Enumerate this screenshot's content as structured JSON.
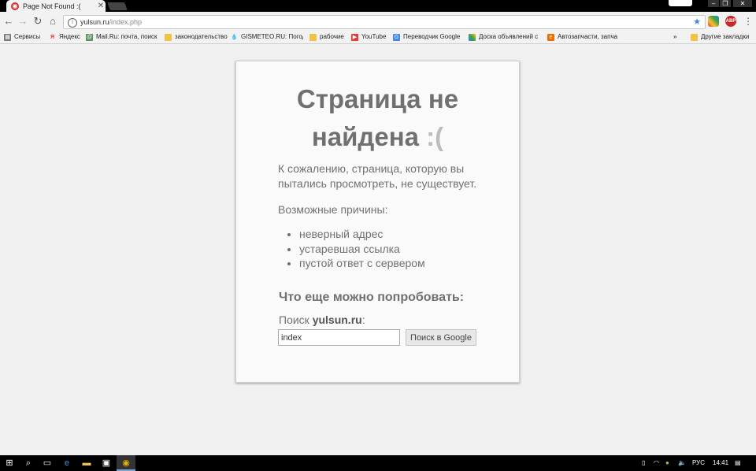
{
  "browser": {
    "tab_title": "Page Not Found :(",
    "address_host": "yulsun.ru",
    "address_path": "/index.php",
    "abp_label": "ABP",
    "bookmarks": [
      "Сервисы",
      "Яндекс",
      "Mail.Ru: почта, поиск",
      "законодательство",
      "GISMETEO.RU: Погод",
      "рабочие",
      "YouTube",
      "Переводчик Google",
      "Доска объявлений с",
      "Автозапчасти, запча"
    ],
    "overflow": "»",
    "other_bookmarks": "Другие закладки"
  },
  "page": {
    "title_line1": "Страница не",
    "title_line2": "найдена",
    "title_smile": ":(",
    "intro": "К сожалению, страница, которую вы пытались просмотреть, не существует.",
    "reasons_heading": "Возможные причины:",
    "reasons": [
      "неверный адрес",
      "устаревшая ссылка",
      "пустой ответ с сервером"
    ],
    "try_heading": "Что еще можно попробовать:",
    "search_prefix": "Поиск",
    "search_site": "yulsun.ru",
    "search_suffix": ":",
    "search_value": "index",
    "search_button": "Поиск в Google"
  },
  "taskbar": {
    "language": "РУС",
    "time": "14:41"
  }
}
